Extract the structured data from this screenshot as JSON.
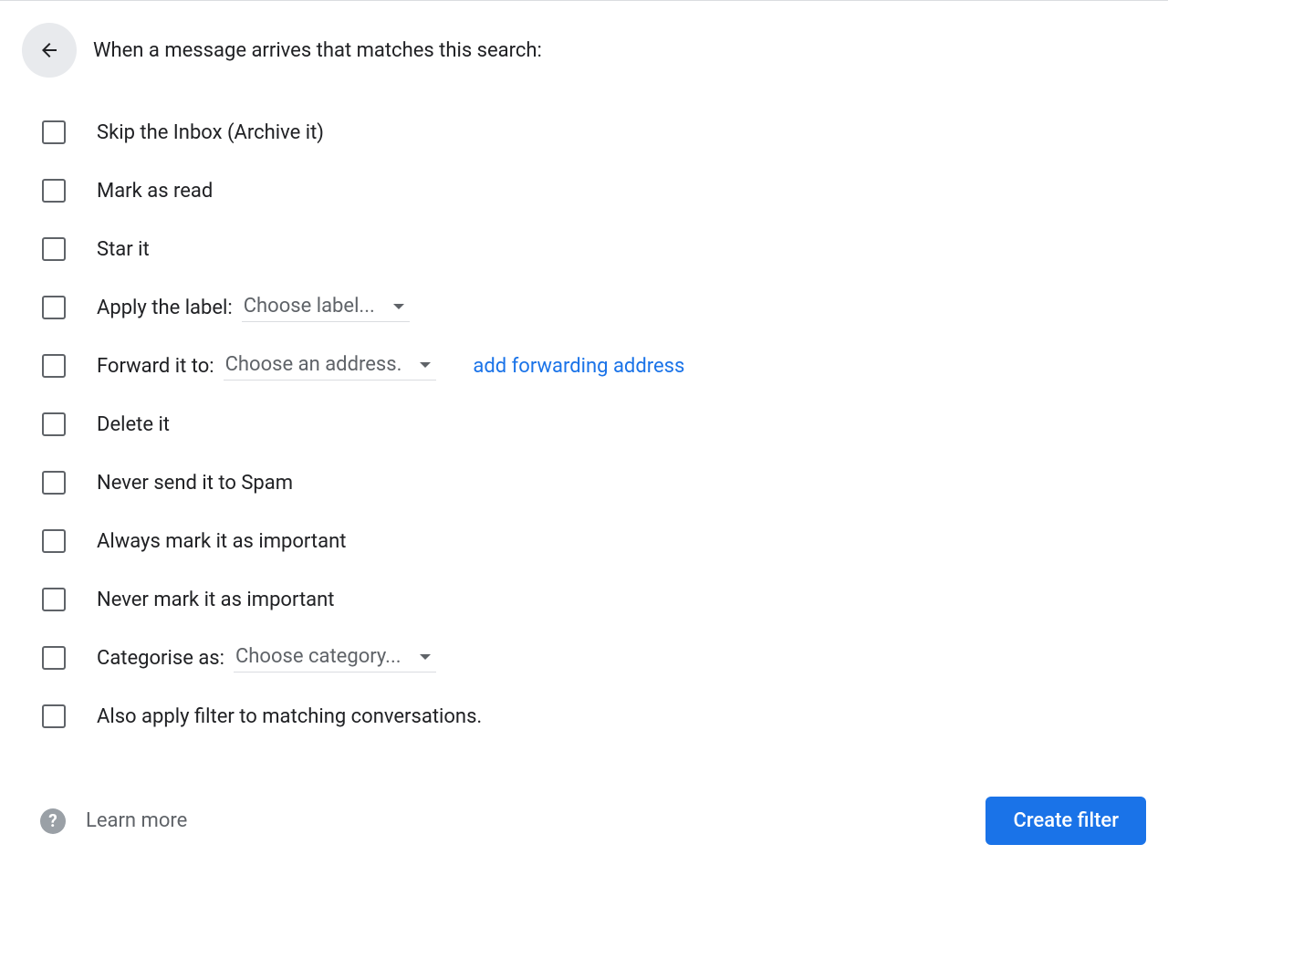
{
  "header": {
    "title": "When a message arrives that matches this search:"
  },
  "options": {
    "skip_inbox": "Skip the Inbox (Archive it)",
    "mark_read": "Mark as read",
    "star_it": "Star it",
    "apply_label": "Apply the label:",
    "apply_label_dropdown": "Choose label...",
    "forward_to": "Forward it to:",
    "forward_dropdown": "Choose an address.",
    "forward_link": "add forwarding address",
    "delete_it": "Delete it",
    "never_spam": "Never send it to Spam",
    "always_important": "Always mark it as important",
    "never_important": "Never mark it as important",
    "categorise_as": "Categorise as:",
    "categorise_dropdown": "Choose category...",
    "also_apply": "Also apply filter to matching conversations."
  },
  "footer": {
    "learn_more": "Learn more",
    "create_filter": "Create filter"
  }
}
